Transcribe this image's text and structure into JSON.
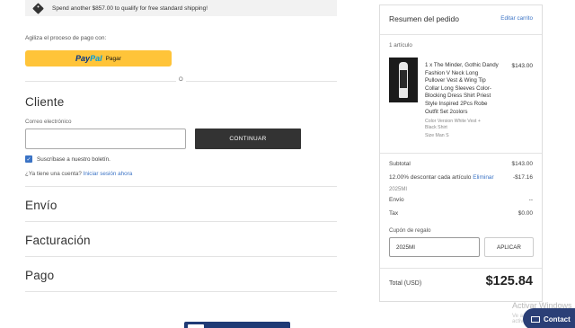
{
  "banner": {
    "icon": "tag-icon",
    "text": "Spend another $857.00 to qualify for free standard shipping!"
  },
  "express": {
    "label": "Agiliza el proceso de pago con:",
    "paypal_logo_a": "Pay",
    "paypal_logo_b": "Pal",
    "paypal_action": "Pagar",
    "separator": "O"
  },
  "sections": {
    "customer": "Cliente",
    "shipping": "Envío",
    "billing": "Facturación",
    "payment": "Pago"
  },
  "customer": {
    "email_label": "Correo electrónico",
    "email_value": "",
    "continue_label": "CONTINUAR",
    "newsletter_label": "Suscríbase a nuestro boletín.",
    "newsletter_checked": true,
    "account_prompt": "¿Ya tiene una cuenta?",
    "login_link": "Iniciar sesión ahora"
  },
  "summary": {
    "title": "Resumen del pedido",
    "edit_label": "Editar carrito",
    "item_count": "1 artículo",
    "product": {
      "name": "1 x The Minder, Gothic Dandy Fashion V Neck Long Pullover Vest & Wing Tip Collar Long Sleeves Color-Blocking Dress Shirt Priest Style Inspired 2Pcs Robe Outfit Set 2colors",
      "variant": "Color Version White Vest + Black Shirt",
      "size": "Size Man S",
      "price": "$143.00"
    },
    "subtotal_label": "Subtotal",
    "subtotal_value": "$143.00",
    "discount_label": "12.00% descontar cada artículo",
    "discount_remove": "Eliminar",
    "discount_value": "-$17.16",
    "discount_code": "2025MI",
    "shipping_label": "Envío",
    "shipping_value": "--",
    "tax_label": "Tax",
    "tax_value": "$0.00",
    "gift_label": "Cupón de regalo",
    "gift_value": "2025MI",
    "apply_label": "APLICAR",
    "total_label": "Total (USD)",
    "total_value": "$125.84"
  },
  "overlay": {
    "watermark": "Activar Windows",
    "watermark_sub": "Ve a Configuración para activar Windows.",
    "contact_label": "Contact"
  }
}
